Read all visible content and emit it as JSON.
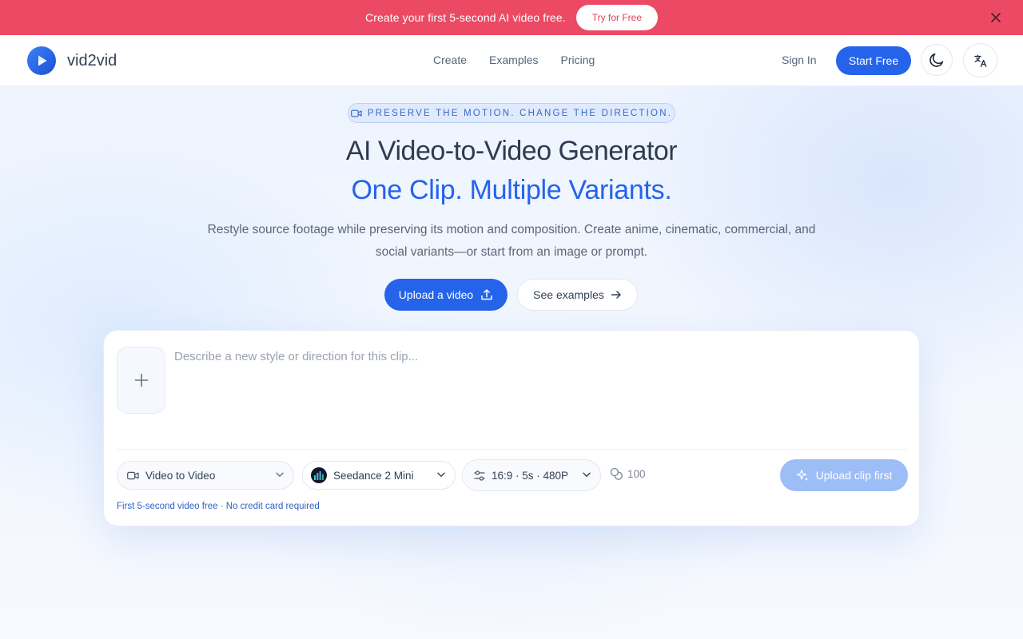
{
  "promo": {
    "text": "Create your first 5-second AI video free.",
    "button": "Try for Free"
  },
  "header": {
    "brand": "vid2vid",
    "nav": [
      "Create",
      "Examples",
      "Pricing"
    ],
    "sign_in": "Sign In",
    "start_free": "Start Free"
  },
  "hero": {
    "tagline": "PRESERVE THE MOTION. CHANGE THE DIRECTION.",
    "title": "AI Video-to-Video Generator",
    "title_accent": "One Clip. Multiple Variants.",
    "subtitle": "Restyle source footage while preserving its motion and composition. Create anime, cinematic, commercial, and social variants—or start from an image or prompt.",
    "cta_upload": "Upload a video",
    "cta_examples": "See examples"
  },
  "composer": {
    "prompt_placeholder": "Describe a new style or direction for this clip...",
    "mode": "Video to Video",
    "model": "Seedance 2 Mini",
    "options": "16:9 · 5s · 480P",
    "credits": "100",
    "submit": "Upload clip first",
    "note": "First 5-second video free · No credit card required"
  },
  "colors": {
    "accent": "#2563eb",
    "promo_bg": "#ec4a64",
    "submit_disabled": "#9dbdf6"
  },
  "icons": [
    "close-icon",
    "play-logo-icon",
    "moon-icon",
    "translate-icon",
    "video-camera-icon",
    "upload-icon",
    "arrow-right-icon",
    "plus-icon",
    "chevron-down-icon",
    "sliders-icon",
    "coins-icon",
    "sparkle-icon"
  ]
}
